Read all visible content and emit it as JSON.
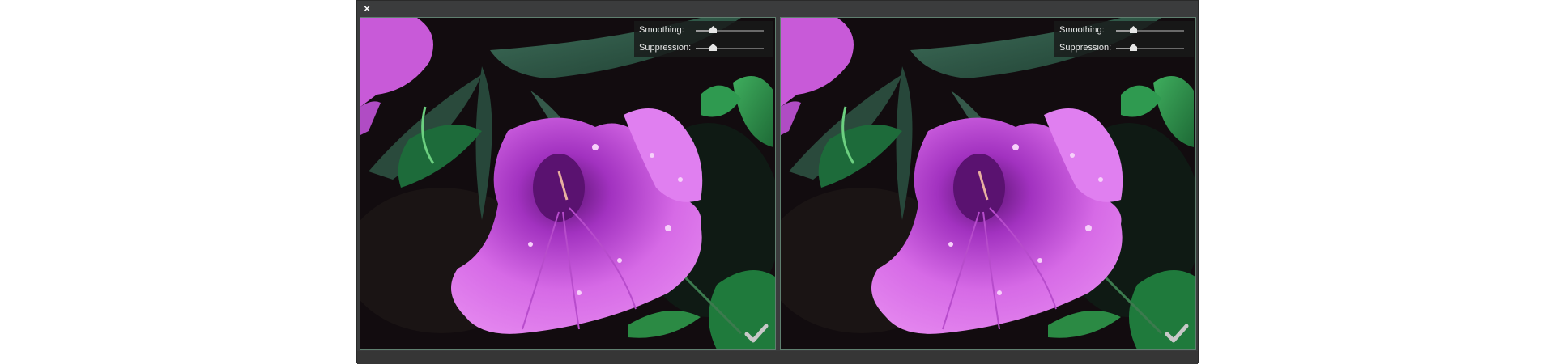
{
  "window": {
    "close_glyph": "×"
  },
  "left_preview": {
    "smoothing_label": "Smoothing:",
    "suppression_label": "Suppression:",
    "smoothing_value": 0.25,
    "suppression_value": 0.25,
    "apply_icon": "checkmark-icon"
  },
  "right_preview": {
    "smoothing_label": "Smoothing:",
    "suppression_label": "Suppression:",
    "smoothing_value": 0.25,
    "suppression_value": 0.25,
    "apply_icon": "checkmark-icon"
  },
  "colors": {
    "panel": "#3b3c3d",
    "petal": "#d86ae8",
    "leaf": "#2d5a45",
    "background": "#100b0d"
  }
}
